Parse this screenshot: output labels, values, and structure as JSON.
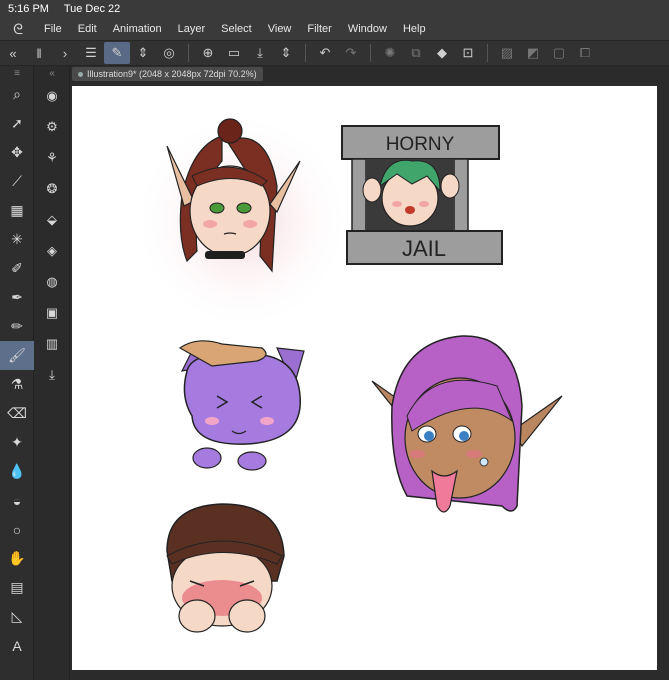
{
  "status": {
    "time": "5:16 PM",
    "date": "Tue Dec 22"
  },
  "menu": [
    "File",
    "Edit",
    "Animation",
    "Layer",
    "Select",
    "View",
    "Filter",
    "Window",
    "Help"
  ],
  "document": {
    "tab_label": "Illustration9* (2048 x 2048px 72dpi 70.2%)"
  },
  "stickers": {
    "horny_jail_top": "HORNY",
    "horny_jail_bottom": "JAIL"
  },
  "colors": {
    "ui_dark": "#2b2b2b",
    "toolbar_active": "#596a86",
    "canvas": "#ffffff"
  }
}
